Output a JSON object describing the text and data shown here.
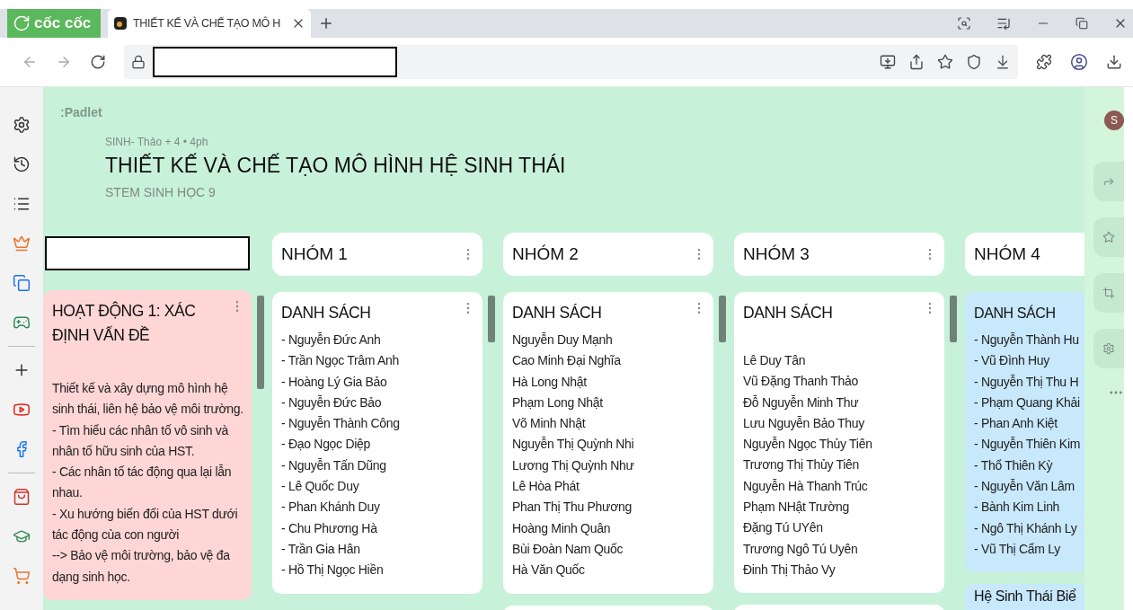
{
  "browser": {
    "brand": "cốc cốc",
    "tab": {
      "title": "THIẾT KẾ VÀ CHẾ TẠO MÔ H",
      "selected": true
    }
  },
  "padlet": {
    "logo": ":Padlet",
    "meta": "SINH- Thảo + 4 • 4ph",
    "title": "THIẾT KẾ VÀ CHẾ TẠO MÔ HÌNH HỆ SINH THÁI",
    "subtitle": "STEM SINH HỌC 9"
  },
  "columns": [
    {
      "redacted": true,
      "posts": [
        {
          "title": "HOẠT ĐỘNG 1: XÁC ĐỊNH VẤN ĐỀ",
          "color": "#ffd6d6",
          "spaced": true,
          "wrap": true,
          "lines": [
            "Thiết kế và xây dựng mô hình hệ sinh thái, liên hệ bảo vệ môi trường.",
            "- Tìm hiểu các nhân tố vô sinh và nhân tố hữu sinh của HST.",
            "- Các nhân tố tác động qua lại lẫn nhau.",
            "- Xu hướng biến đổi của HST dưới tác động của con người",
            "--> Bảo vệ môi trường, bảo vệ đa dạng sinh học."
          ]
        }
      ]
    },
    {
      "title": "NHÓM 1",
      "posts": [
        {
          "title": "DANH SÁCH",
          "color": "#ffffff",
          "spaced": false,
          "lines": [
            "- Nguyễn Đức Anh",
            "- Trần  Ngọc Trâm Anh",
            "- Hoàng Lý Gia Bảo",
            "- Nguyễn Đức Bảo",
            "- Nguyễn Thành Công",
            "- Đạo Ngọc Diệp",
            "- Nguyễn Tấn Dũng",
            "- Lê Quốc Duy",
            "- Phan Khánh Duy",
            "- Chu Phương Hà",
            "- Trần Gia Hân",
            "- Hồ Thị Ngọc Hiền"
          ]
        }
      ]
    },
    {
      "title": "NHÓM 2",
      "posts": [
        {
          "title": "DANH SÁCH",
          "color": "#ffffff",
          "spaced": false,
          "lines": [
            "Nguyễn Duy Mạnh",
            "Cao Minh Đại Nghĩa",
            "Hà Long Nhật",
            "Phạm Long Nhật",
            "Võ Minh Nhật",
            "Nguyễn Thị Quỳnh Nhi",
            "Lương Thị Quỳnh Như",
            "Lê Hòa Phát",
            "Phan Thị Thu Phương",
            "Hoàng Minh Quân",
            "Bùi Đoàn Nam Quốc",
            "Hà Văn Quốc"
          ]
        },
        {
          "color": "#ffffff"
        }
      ]
    },
    {
      "title": "NHÓM 3",
      "posts": [
        {
          "title": "DANH SÁCH",
          "color": "#ffffff",
          "spaced": true,
          "lines": [
            "Lê Duy Tân",
            "Vũ Đặng Thanh Thảo",
            "Đỗ Nguyễn Minh Thư",
            "Lưu Nguyễn Bảo Thuy",
            "Nguyễn Ngọc Thủy Tiên",
            "Trương Thị Thủy Tiên",
            "Nguyễn Hà Thanh Trúc",
            "Phạm NHật Trường",
            "Đặng Tú UYên",
            "Trương Ngô Tú Uyên",
            "Đinh Thị Thảo Vy"
          ]
        },
        {
          "color": "#ffffff"
        }
      ]
    },
    {
      "title": "NHÓM 4",
      "posts": [
        {
          "title": "DANH SÁCH",
          "color": "#c8e8fc",
          "spaced": false,
          "lines": [
            "- Nguyễn Thành Hu",
            "- Vũ Đình Huy",
            "- Nguyễn Thị Thu H",
            "- Phạm Quang Khải",
            "- Phan Anh Kiệt",
            "- Nguyễn Thiên Kim",
            "- Thổ Thiên Kỳ",
            "- Nguyễn Văn Lâm",
            "- Bành Kim Linh",
            "- Ngô Thị Khánh Ly",
            "- Vũ Thị Cẩm Ly"
          ]
        },
        {
          "title": "Hệ Sinh Thái Biể",
          "color": "#c8e8fc"
        }
      ]
    }
  ],
  "rail": {
    "avatar": "S"
  }
}
